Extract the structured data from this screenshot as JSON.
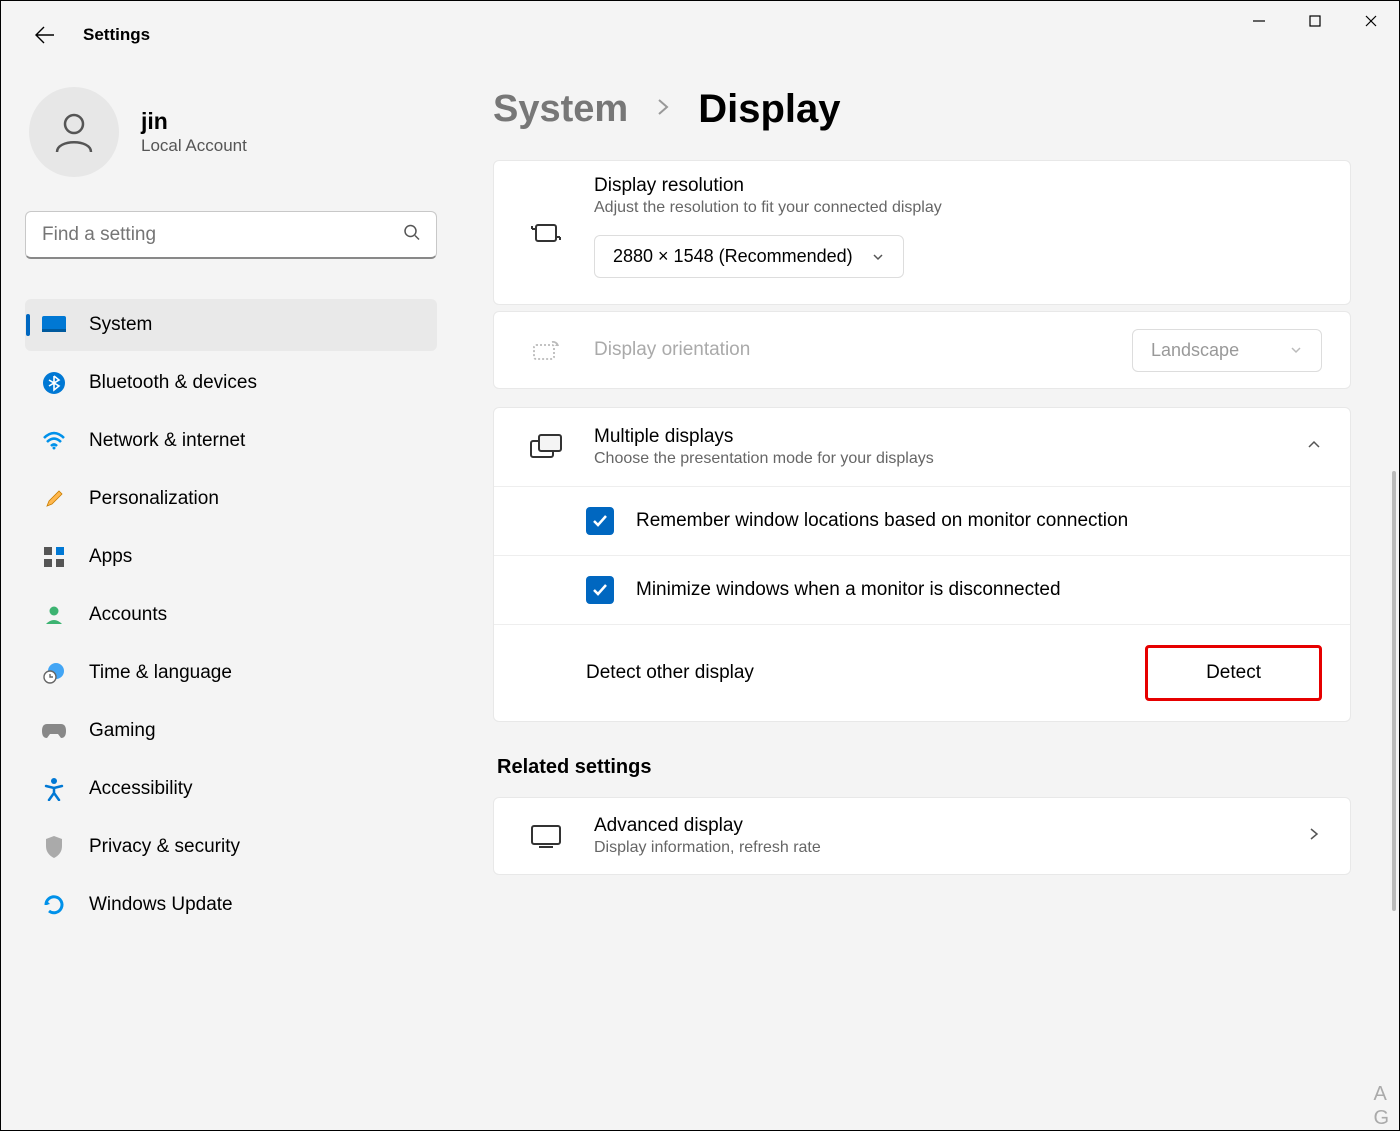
{
  "appTitle": "Settings",
  "profile": {
    "name": "jin",
    "type": "Local Account"
  },
  "search": {
    "placeholder": "Find a setting"
  },
  "nav": [
    {
      "label": "System",
      "active": true
    },
    {
      "label": "Bluetooth & devices"
    },
    {
      "label": "Network & internet"
    },
    {
      "label": "Personalization"
    },
    {
      "label": "Apps"
    },
    {
      "label": "Accounts"
    },
    {
      "label": "Time & language"
    },
    {
      "label": "Gaming"
    },
    {
      "label": "Accessibility"
    },
    {
      "label": "Privacy & security"
    },
    {
      "label": "Windows Update"
    }
  ],
  "breadcrumb": {
    "parent": "System",
    "current": "Display"
  },
  "resolution": {
    "title": "Display resolution",
    "sub": "Adjust the resolution to fit your connected display",
    "value": "2880 × 1548 (Recommended)"
  },
  "orientation": {
    "title": "Display orientation",
    "value": "Landscape"
  },
  "multiple": {
    "title": "Multiple displays",
    "sub": "Choose the presentation mode for your displays",
    "opt1": "Remember window locations based on monitor connection",
    "opt2": "Minimize windows when a monitor is disconnected",
    "detectLabel": "Detect other display",
    "detectButton": "Detect"
  },
  "related": {
    "heading": "Related settings",
    "advanced": {
      "title": "Advanced display",
      "sub": "Display information, refresh rate"
    }
  },
  "watermark": {
    "l1": "A",
    "l2": "G"
  }
}
